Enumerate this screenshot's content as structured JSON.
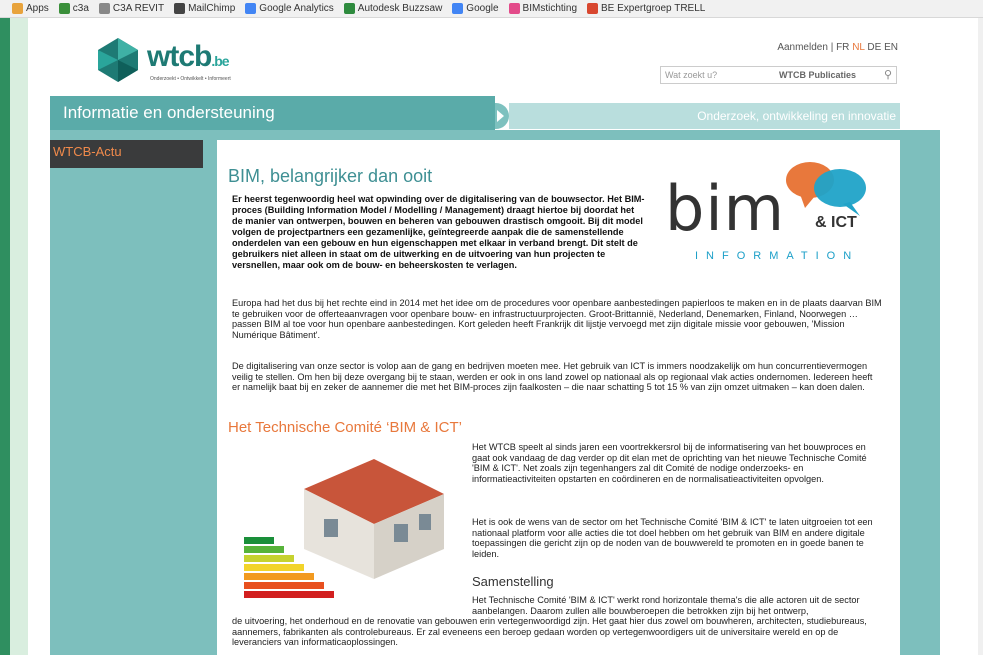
{
  "bookmarks": [
    {
      "label": "Apps",
      "icon": "apps-grid-icon",
      "color": "#e8a33c"
    },
    {
      "label": "c3a",
      "icon": "c3a-icon",
      "color": "#3a8f3a"
    },
    {
      "label": "C3A REVIT",
      "icon": "page-icon",
      "color": "#888888"
    },
    {
      "label": "MailChimp",
      "icon": "mailchimp-icon",
      "color": "#444444"
    },
    {
      "label": "Google Analytics",
      "icon": "google-icon",
      "color": "#4285f4"
    },
    {
      "label": "Autodesk Buzzsaw",
      "icon": "buzzsaw-icon",
      "color": "#2e8b3e"
    },
    {
      "label": "Google",
      "icon": "google-icon",
      "color": "#4285f4"
    },
    {
      "label": "BIMstichting",
      "icon": "bimstichting-icon",
      "color": "#e34b8a"
    },
    {
      "label": "BE Expertgroep TRELL",
      "icon": "trello-icon",
      "color": "#d8472f"
    }
  ],
  "header": {
    "logo_text": "wtcb",
    "logo_suffix": ".be",
    "tagline": "Onderzoekt • Ontwikkelt • Informeert",
    "login": "Aanmelden",
    "sep": "|",
    "languages": [
      "FR",
      "NL",
      "DE",
      "EN"
    ],
    "active_language": "NL",
    "search_placeholder": "Wat zoekt u?",
    "search_scope": "WTCB Publicaties"
  },
  "nav": {
    "left": "Informatie en ondersteuning",
    "right": "Onderzoek, ontwikkeling en innovatie"
  },
  "sidebar": {
    "active_item": "WTCB-Actu"
  },
  "article": {
    "title": "BIM, belangrijker dan ooit",
    "lead": "Er heerst tegenwoordig heel wat opwinding over de digitalisering van de bouwsector. Het BIM-proces (Building Information Model / Modelling / Management) draagt hiertoe bij doordat het de manier van ontwerpen, bouwen en beheren van gebouwen drastisch omgooit. Bij dit model volgen de projectpartners een gezamenlijke, geïntegreerde aanpak die de samenstellende onderdelen van een gebouw en hun eigenschappen met elkaar in verband brengt. Dit stelt de gebruikers niet alleen in staat om de uitwerking en de uitvoering van hun projecten te versnellen, maar ook om de bouw- en beheerskosten te verlagen.",
    "para1": "Europa had het dus bij het rechte eind in 2014 met het idee om de procedures voor openbare aanbestedingen papierloos te maken en in de plaats daarvan BIM te gebruiken voor de offerteaanvragen voor openbare bouw- en infrastructuurprojecten. Groot-Brittannië, Nederland, Denemarken, Finland, Noorwegen … passen BIM al toe voor hun openbare aanbestedingen. Kort geleden heeft Frankrijk dit lijstje vervoegd met zijn digitale missie voor gebouwen, 'Mission Numérique Bâtiment'.",
    "para2": "De digitalisering van onze sector is volop aan de gang en bedrijven moeten mee. Het gebruik van ICT is immers noodzakelijk om hun concurrentievermogen veilig te stellen. Om hen bij deze overgang bij te staan, werden er ook in ons land zowel op nationaal als op regionaal vlak acties ondernomen. Iedereen heeft er namelijk baat bij en zeker de aannemer die met het BIM-proces zijn faalkosten – die naar schatting 5 tot 15 % van zijn omzet uitmaken – kan doen dalen.",
    "section_title": "Het Technische Comité ‘BIM & ICT’",
    "section_para1": "Het WTCB speelt al sinds jaren een voortrekkersrol bij de informatisering van het bouwproces en gaat ook vandaag de dag verder op dit elan met de oprichting van het nieuwe Technische Comité 'BIM & ICT'. Net zoals zijn tegenhangers zal dit Comité de nodige onderzoeks- en informatieactiviteiten opstarten en coördineren en de normalisatieactiviteiten opvolgen.",
    "section_para2": "Het is ook de wens van de sector om het Technische Comité 'BIM & ICT' te laten uitgroeien tot een nationaal platform voor alle acties die tot doel hebben om het gebruik van BIM en andere digitale toepassingen die gericht zijn op de noden van de bouwwereld te promoten en in goede banen te leiden.",
    "subsection_title": "Samenstelling",
    "subsection_para_a": "Het Technische Comité 'BIM & ICT' werkt rond horizontale thema's die alle actoren uit de sector aanbelangen. Daarom zullen alle bouwberoepen die betrokken zijn bij het ontwerp,",
    "subsection_para_b": "de uitvoering, het onderhoud en de renovatie van gebouwen erin vertegenwoordigd zijn. Het gaat hier dus zowel om bouwheren, architecten, studiebureaus, aannemers, fabrikanten als controlebureaus. Er zal eveneens een beroep gedaan worden op vertegenwoordigers uit de universitaire wereld en op de leveranciers van informaticaoplossingen."
  },
  "bim_logo": {
    "word": "bim",
    "suffix": "& ICT",
    "subtitle": "INFORMATION"
  },
  "colors": {
    "teal_dark": "#5aaba9",
    "teal_light": "#b9dedd",
    "accent_orange": "#e8783c",
    "title_teal": "#3e8f93"
  }
}
